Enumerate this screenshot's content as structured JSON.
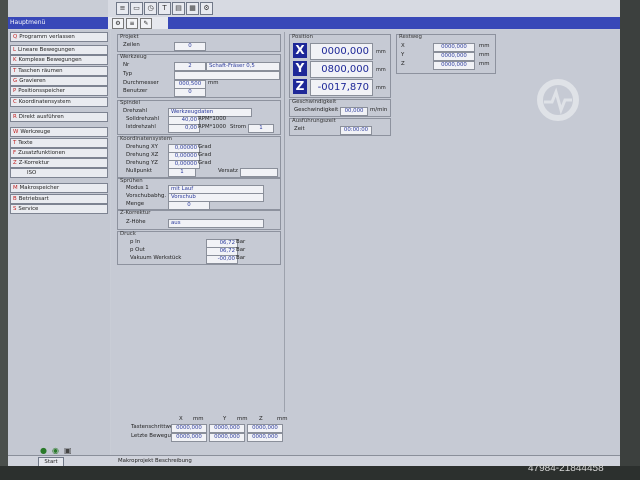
{
  "window": {
    "title": "Hauptmenü"
  },
  "sidebar": {
    "items": [
      {
        "key": "Q",
        "label": "Programm verlassen"
      },
      {
        "key": "L",
        "label": "Lineare Bewegungen"
      },
      {
        "key": "K",
        "label": "Komplexe Bewegungen"
      },
      {
        "key": "T",
        "label": "Taschen räumen"
      },
      {
        "key": "G",
        "label": "Gravieren"
      },
      {
        "key": "P",
        "label": "Positionsspeicher"
      },
      {
        "key": "C",
        "label": "Koordinatensystem"
      },
      {
        "key": "R",
        "label": "Direkt ausführen"
      },
      {
        "key": "W",
        "label": "Werkzeuge"
      },
      {
        "key": "T",
        "label": "Texte"
      },
      {
        "key": "F",
        "label": "Zusatzfunktionen"
      },
      {
        "key": "Z",
        "label": "Z-Korrektur"
      },
      {
        "key": "",
        "label": "ISO"
      },
      {
        "key": "M",
        "label": "Makrospeicher"
      },
      {
        "key": "B",
        "label": "Betriebsart"
      },
      {
        "key": "S",
        "label": "Service"
      }
    ]
  },
  "projekt": {
    "title": "Projekt",
    "zeilen_label": "Zeilen",
    "zeilen_value": "0"
  },
  "werkzeug": {
    "title": "Werkzeug",
    "nr_label": "Nr",
    "nr_value": "2",
    "nr_name": "Schaft-Fräser 0,5",
    "typ_label": "Typ",
    "durchmesser_label": "Durchmesser",
    "durchmesser_value": "000,500",
    "durchmesser_unit": "mm",
    "benutzer_label": "Benutzer",
    "benutzer_value": "0"
  },
  "spindel": {
    "title": "Spindel",
    "drehzahl_label": "Drehzahl",
    "drehzahl_value": "Werkzeugdaten",
    "soll_label": "Solldrehzahl",
    "soll_value": "40,00",
    "soll_unit": "RPM*1000",
    "ist_label": "Istdrehzahl",
    "ist_value": "0,00",
    "ist_unit": "RPM*1000",
    "strom_label": "Strom",
    "strom_value": "1"
  },
  "koord": {
    "title": "Koordinatensystem",
    "xy_label": "Drehung XY",
    "xy_value": "0,00000",
    "xy_unit": "Grad",
    "xz_label": "Drehung XZ",
    "xz_value": "0,00000",
    "xz_unit": "Grad",
    "yz_label": "Drehung YZ",
    "yz_value": "0,00000",
    "yz_unit": "Grad",
    "null_label": "Nullpunkt",
    "null_value": "1",
    "versatz_label": "Versatz"
  },
  "spruehen": {
    "title": "Sprühen",
    "modus_label": "Modus 1",
    "modus_value": "mit Lauf",
    "vor_label": "Vorschubabhg.",
    "vor_value": "Vorschub",
    "menge_label": "Menge",
    "menge_value": "0"
  },
  "zkorrektur": {
    "title": "Z-Korrektur",
    "hoehe_label": "Z-Höhe",
    "hoehe_value": "aus"
  },
  "druck": {
    "title": "Druck",
    "pin_label": "p In",
    "pin_value": "06,72",
    "pin_unit": "Bar",
    "pout_label": "p Out",
    "pout_value": "06,72",
    "pout_unit": "Bar",
    "vak_label": "Vakuum Werkstück",
    "vak_value": "-00,00",
    "vak_unit": "Bar"
  },
  "position": {
    "title": "Position",
    "x_label": "X",
    "x_value": "0000,000",
    "x_unit": "mm",
    "y_label": "Y",
    "y_value": "0800,000",
    "y_unit": "mm",
    "z_label": "Z",
    "z_value": "-0017,870",
    "z_unit": "mm"
  },
  "restweg": {
    "title": "Restweg",
    "x_label": "X",
    "x_value": "0000,000",
    "x_unit": "mm",
    "y_label": "Y",
    "y_value": "0000,000",
    "y_unit": "mm",
    "z_label": "Z",
    "z_value": "0000,000",
    "z_unit": "mm"
  },
  "geschw": {
    "title": "Geschwindigkeit",
    "label": "Geschwindigkeit",
    "value": "00,000",
    "unit": "m/min"
  },
  "ausfzeit": {
    "title": "Ausführungszeit",
    "zeit_label": "Zeit",
    "zeit_value": "00:00:00"
  },
  "bottomtable": {
    "hdr_x": "X",
    "hdr_xunit": "mm",
    "hdr_y": "Y",
    "hdr_yunit": "mm",
    "hdr_z": "Z",
    "hdr_zunit": "mm",
    "row1_label": "Tastenschrittweite",
    "row1_x": "0000,000",
    "row1_y": "0000,000",
    "row1_z": "0000,000",
    "row2_label": "Letzte Bewegung",
    "row2_x": "0000,000",
    "row2_y": "0000,000",
    "row2_z": "0000,000"
  },
  "taskbar": {
    "start_label": "Start",
    "task_label": "Makroprojekt Beschreibung"
  },
  "watermark": {
    "text": "47984-21844458"
  },
  "colors": {
    "accent": "#1e2898",
    "titlebar": "#3848b8",
    "panel": "#c6cad4"
  },
  "icons": [
    "gear-icon",
    "folder-icon",
    "text-tool-icon",
    "list-icon",
    "clock-icon",
    "window-icon"
  ]
}
